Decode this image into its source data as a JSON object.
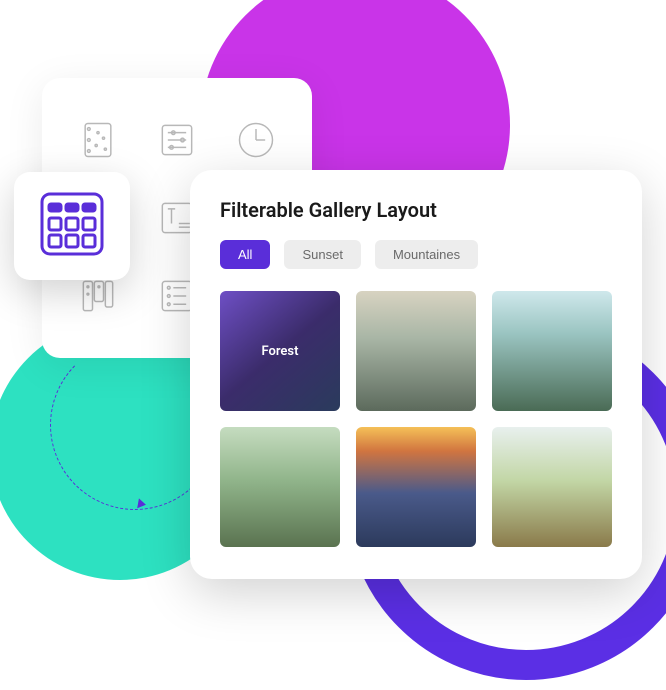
{
  "gallery": {
    "title": "Filterable Gallery Layout",
    "filters": [
      {
        "label": "All",
        "active": true
      },
      {
        "label": "Sunset",
        "active": false
      },
      {
        "label": "Mountaines",
        "active": false
      }
    ],
    "items": [
      {
        "label": "Forest",
        "icon": "forest-image"
      },
      {
        "label": "",
        "icon": "clouds-image"
      },
      {
        "label": "",
        "icon": "waterfall-image"
      },
      {
        "label": "",
        "icon": "horse-image"
      },
      {
        "label": "",
        "icon": "sunset-mountain-image"
      },
      {
        "label": "",
        "icon": "savanna-image"
      }
    ]
  },
  "icon_panel": {
    "highlighted": "grid-icon",
    "icons": [
      "notebook-icon",
      "sliders-icon",
      "clock-icon",
      "dots-icon",
      "text-column-icon",
      "post-icon",
      "kanban-icon",
      "list-icon",
      "columns-icon"
    ]
  },
  "colors": {
    "accent": "#5a2ed9",
    "magenta": "#c934e8",
    "teal": "#2de1c1",
    "filter_inactive_bg": "#ededed",
    "filter_inactive_text": "#6a6a6a"
  }
}
